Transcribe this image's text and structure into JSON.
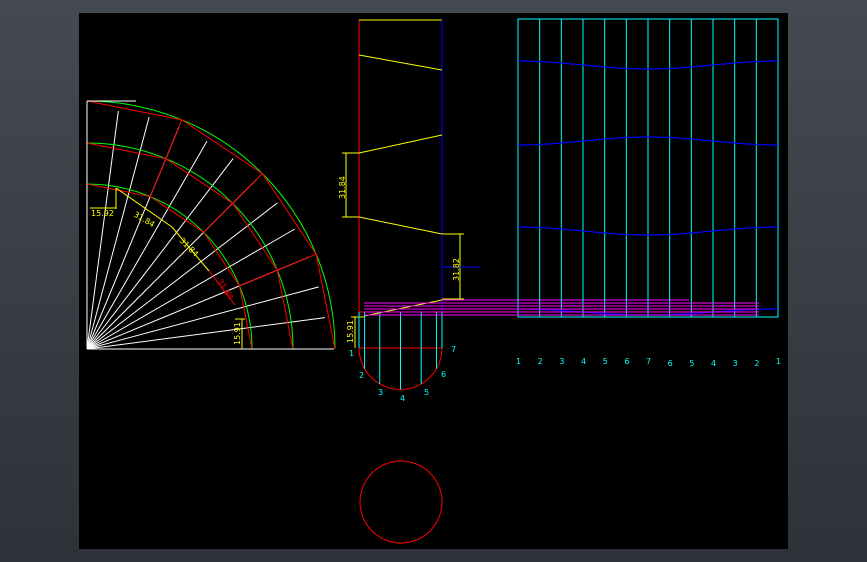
{
  "drawing": {
    "colors": {
      "background": "#000000",
      "outline_red": "#ff0000",
      "arc_green": "#00ff00",
      "construction_white": "#ffffff",
      "dimension_yellow": "#ffff00",
      "blue": "#0000ff",
      "cyan": "#00ffff",
      "magenta": "#ff00ff"
    },
    "elbow_view": {
      "dims": [
        "15.92",
        "31.84",
        "31.84",
        "31.84",
        "15.91"
      ]
    },
    "side_view": {
      "dims": [
        "31.84",
        "31.82",
        "15.91"
      ],
      "point_labels": [
        "1",
        "2",
        "3",
        "4",
        "5",
        "6",
        "7"
      ]
    },
    "unfold_view": {
      "column_labels": [
        "1",
        "2",
        "3",
        "4",
        "5",
        "6",
        "7",
        "6",
        "5",
        "4",
        "3",
        "2",
        "1"
      ]
    },
    "section_view": {
      "shape": "circle"
    }
  }
}
